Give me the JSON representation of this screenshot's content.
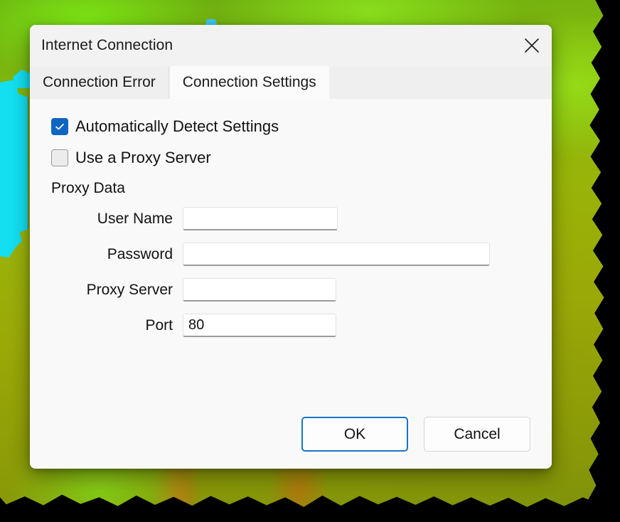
{
  "background": {
    "name": "elevation-terrain-raster",
    "description": "Green-to-olive elevation raster with cyan water bodies and black nodata edges",
    "colors": {
      "terrain_bright_green": "#7ce814",
      "terrain_olive": "#99b409",
      "terrain_orange": "#c46e14",
      "water_cyan": "#14dff0",
      "nodata_black": "#000000"
    }
  },
  "dialog": {
    "title": "Internet Connection",
    "close_icon": "close-icon",
    "tabs": [
      {
        "label": "Connection Error",
        "active": false
      },
      {
        "label": "Connection Settings",
        "active": true
      }
    ],
    "checkboxes": [
      {
        "label": "Automatically Detect Settings",
        "checked": true
      },
      {
        "label": "Use a Proxy Server",
        "checked": false
      }
    ],
    "group_label": "Proxy Data",
    "fields": [
      {
        "label": "User Name",
        "value": "",
        "placeholder": ""
      },
      {
        "label": "Password",
        "value": "",
        "placeholder": ""
      },
      {
        "label": "Proxy Server",
        "value": "",
        "placeholder": ""
      },
      {
        "label": "Port",
        "value": "80",
        "placeholder": ""
      }
    ],
    "buttons": {
      "ok": "OK",
      "cancel": "Cancel"
    },
    "colors": {
      "accent": "#0f66c0",
      "focus_border": "#1a73c8",
      "dialog_bg": "#f9f9f9",
      "titlebar_bg": "#f2f2f2",
      "tabstrip_bg": "#efefef",
      "active_tab_bg": "#fbfbfb"
    }
  }
}
